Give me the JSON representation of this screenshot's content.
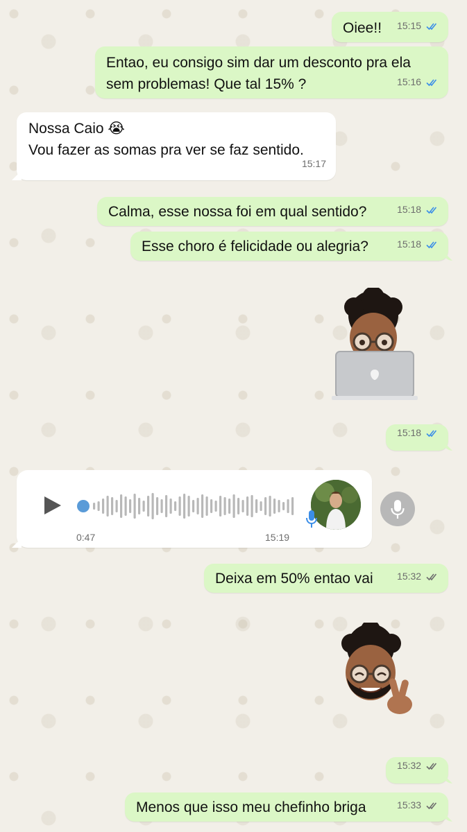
{
  "colors": {
    "outgoing_bubble": "#dbf7c6",
    "incoming_bubble": "#ffffff",
    "read_ticks": "#3b8ee8",
    "delivered_ticks": "#6d6d6d",
    "wallpaper": "#efeae2"
  },
  "messages": [
    {
      "id": "m1",
      "direction": "out",
      "text": "Oiee!!",
      "time": "15:15",
      "status": "read"
    },
    {
      "id": "m2",
      "direction": "out",
      "lines": [
        "Entao, eu consigo sim dar um desconto pra ela",
        "sem problemas! Que tal 15% ?"
      ],
      "time": "15:16",
      "status": "read"
    },
    {
      "id": "m3",
      "direction": "in",
      "lines": [
        "Nossa Caio 😭",
        "Vou fazer as somas pra ver se faz sentido."
      ],
      "time": "15:17"
    },
    {
      "id": "m4",
      "direction": "out",
      "text": "Calma, esse nossa foi em qual sentido?",
      "time": "15:18",
      "status": "read"
    },
    {
      "id": "m5",
      "direction": "out",
      "text": "Esse choro é felicidade ou alegria?",
      "time": "15:18",
      "status": "read"
    },
    {
      "id": "m6",
      "direction": "out",
      "type": "sticker",
      "sticker": "memoji-laptop-sticker",
      "time": "15:18",
      "status": "read"
    },
    {
      "id": "m7",
      "direction": "in",
      "type": "voice",
      "duration": "0:47",
      "time": "15:19",
      "progress": 0.0
    },
    {
      "id": "m8",
      "direction": "out",
      "text": "Deixa em 50% entao vai",
      "time": "15:32",
      "status": "delivered"
    },
    {
      "id": "m9",
      "direction": "out",
      "type": "sticker",
      "sticker": "memoji-peace-sign-sticker",
      "time": "15:32",
      "status": "delivered"
    },
    {
      "id": "m10",
      "direction": "out",
      "text": "Menos que isso meu chefinho briga",
      "time": "15:33",
      "status": "delivered"
    }
  ],
  "icons": {
    "read": "double-check-icon",
    "delivered": "double-check-icon",
    "play": "play-icon",
    "mic": "microphone-icon"
  }
}
